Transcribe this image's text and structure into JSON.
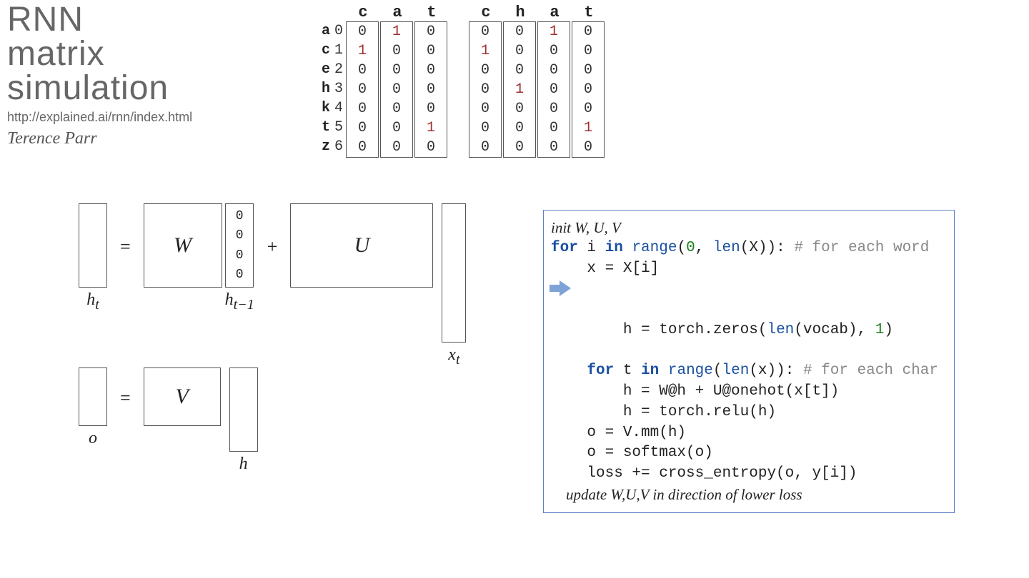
{
  "title": {
    "line1": "RNN",
    "line2": "matrix",
    "line3": "simulation"
  },
  "url": "http://explained.ai/rnn/index.html",
  "author": "Terence Parr",
  "vocab": {
    "letters": [
      "a",
      "c",
      "e",
      "h",
      "k",
      "t",
      "z"
    ],
    "indices": [
      "0",
      "1",
      "2",
      "3",
      "4",
      "5",
      "6"
    ],
    "words": [
      {
        "chars": [
          "c",
          "a",
          "t"
        ],
        "cols": [
          [
            "0",
            "1",
            "0",
            "0",
            "0",
            "0",
            "0"
          ],
          [
            "1",
            "0",
            "0",
            "0",
            "0",
            "0",
            "0"
          ],
          [
            "0",
            "0",
            "0",
            "0",
            "0",
            "1",
            "0"
          ]
        ]
      },
      {
        "chars": [
          "c",
          "h",
          "a",
          "t"
        ],
        "cols": [
          [
            "0",
            "1",
            "0",
            "0",
            "0",
            "0",
            "0"
          ],
          [
            "0",
            "0",
            "0",
            "1",
            "0",
            "0",
            "0"
          ],
          [
            "1",
            "0",
            "0",
            "0",
            "0",
            "0",
            "0"
          ],
          [
            "0",
            "0",
            "0",
            "0",
            "0",
            "1",
            "0"
          ]
        ]
      }
    ]
  },
  "eqn": {
    "eq": "=",
    "plus": "+",
    "W": "W",
    "U": "U",
    "V": "V",
    "zeros": [
      "0",
      "0",
      "0",
      "0"
    ],
    "labels": {
      "ht": "h",
      "ht_sub": "t",
      "htm1": "h",
      "htm1_sub": "t−1",
      "xt": "x",
      "xt_sub": "t",
      "o": "o",
      "h": "h"
    }
  },
  "code": {
    "l0": "init W, U, V",
    "l1_for": "for",
    "l1_in": "in",
    "l1_range": "range",
    "l1_zero": "0",
    "l1_len": "len",
    "l1_rest1": " i ",
    "l1_rest2": " ",
    "l1_rest3": "(",
    "l1_rest4": ", ",
    "l1_rest5": "(X)): ",
    "l1_cmt": "# for each word",
    "l2": "    x = X[i]",
    "l3blank": "",
    "l4a": "    h = torch.zeros(",
    "l4_len": "len",
    "l4b": "(vocab), ",
    "l4_one": "1",
    "l4c": ")",
    "l5_for": "for",
    "l5_in": "in",
    "l5_range": "range",
    "l5_len": "len",
    "l5_pre": "    ",
    "l5_mid1": " t ",
    "l5_mid2": " ",
    "l5_mid3": "(",
    "l5_mid4": "(x)): ",
    "l5_cmt": "# for each char",
    "l6": "        h = W@h + U@onehot(x[t])",
    "l7": "        h = torch.relu(h)",
    "l8": "    o = V.mm(h)",
    "l9": "    o = softmax(o)",
    "l10blank": "",
    "l11": "    loss += cross_entropy(o, y[i])",
    "l12": "    update W,U,V in direction of lower loss"
  }
}
